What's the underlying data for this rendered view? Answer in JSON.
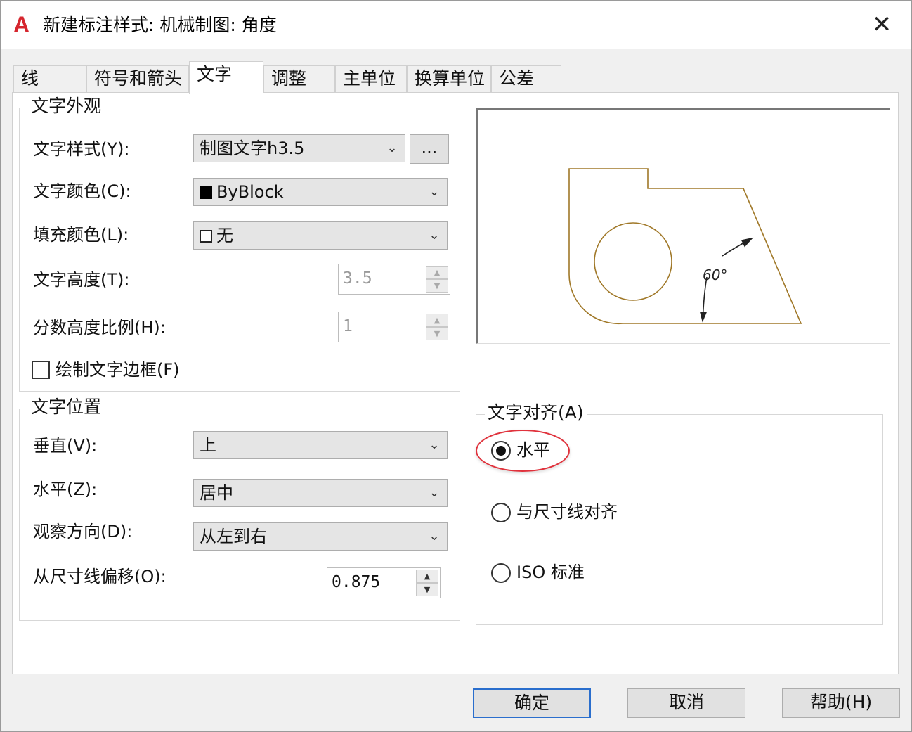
{
  "window": {
    "title": "新建标注样式: 机械制图: 角度",
    "app_logo": "A",
    "close_label": "✕"
  },
  "tabs": [
    {
      "label": "线"
    },
    {
      "label": "符号和箭头"
    },
    {
      "label": "文字",
      "active": true
    },
    {
      "label": "调整"
    },
    {
      "label": "主单位"
    },
    {
      "label": "换算单位"
    },
    {
      "label": "公差"
    }
  ],
  "text_appearance": {
    "title": "文字外观",
    "style_label": "文字样式(Y):",
    "style_value": "制图文字h3.5",
    "style_ellipsis": "...",
    "color_label": "文字颜色(C):",
    "color_value": "ByBlock",
    "fill_label": "填充颜色(L):",
    "fill_value": "无",
    "height_label": "文字高度(T):",
    "height_value": "3.5",
    "fraction_label": "分数高度比例(H):",
    "fraction_value": "1",
    "frame_label": "绘制文字边框(F)",
    "frame_checked": false
  },
  "text_placement": {
    "title": "文字位置",
    "vertical_label": "垂直(V):",
    "vertical_value": "上",
    "horizontal_label": "水平(Z):",
    "horizontal_value": "居中",
    "view_dir_label": "观察方向(D):",
    "view_dir_value": "从左到右",
    "offset_label": "从尺寸线偏移(O):",
    "offset_value": "0.875"
  },
  "preview": {
    "angle_text": "60°",
    "line_color": "#a07828",
    "dim_color": "#222222"
  },
  "text_alignment": {
    "title": "文字对齐(A)",
    "options": [
      {
        "label": "水平",
        "selected": true
      },
      {
        "label": "与尺寸线对齐",
        "selected": false
      },
      {
        "label": "ISO 标准",
        "selected": false
      }
    ],
    "highlight_color": "#e0323c"
  },
  "buttons": {
    "ok": "确定",
    "cancel": "取消",
    "help": "帮助(H)"
  }
}
